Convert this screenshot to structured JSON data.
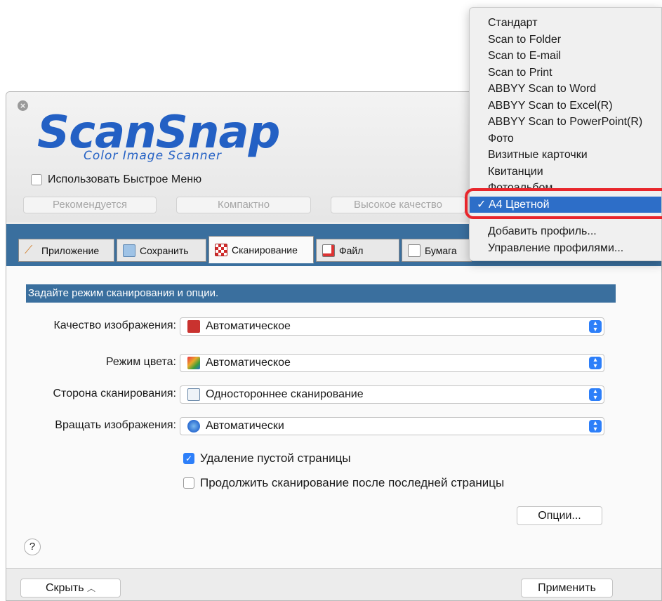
{
  "window": {
    "close_icon": "close-icon",
    "logo_title": "ScanSnap",
    "logo_subtitle": "Color Image Scanner"
  },
  "quick_menu": {
    "label": "Использовать Быстрое Меню",
    "checked": false
  },
  "presets": [
    {
      "label": "Рекомендуется"
    },
    {
      "label": "Компактно"
    },
    {
      "label": "Высокое качество"
    }
  ],
  "tabs": [
    {
      "label": "Приложение",
      "icon": "application-icon"
    },
    {
      "label": "Сохранить",
      "icon": "folder-icon"
    },
    {
      "label": "Сканирование",
      "icon": "scan-icon",
      "active": true
    },
    {
      "label": "Файл",
      "icon": "file-icon"
    },
    {
      "label": "Бумага",
      "icon": "paper-icon"
    }
  ],
  "scan_panel": {
    "header": "Задайте режим сканирования и опции.",
    "fields": [
      {
        "label": "Качество изображения:",
        "value": "Автоматическое",
        "icon": "image-quality-icon"
      },
      {
        "label": "Режим цвета:",
        "value": "Автоматическое",
        "icon": "color-mode-icon"
      },
      {
        "label": "Сторона сканирования:",
        "value": "Одностороннее сканирование",
        "icon": "scan-side-icon"
      },
      {
        "label": "Вращать изображения:",
        "value": "Автоматически",
        "icon": "rotate-icon"
      }
    ],
    "checkboxes": [
      {
        "label": "Удаление пустой страницы",
        "checked": true
      },
      {
        "label": "Продолжить сканирование после последней страницы",
        "checked": false
      }
    ],
    "options_button": "Опции...",
    "help_button": "?"
  },
  "bottom": {
    "hide_button": "Скрыть",
    "apply_button": "Применить"
  },
  "profile_menu": {
    "items": [
      "Стандарт",
      "Scan to Folder",
      "Scan to E-mail",
      "Scan to Print",
      "ABBYY Scan to Word",
      "ABBYY Scan to Excel(R)",
      "ABBYY Scan to PowerPoint(R)",
      "Фото",
      "Визитные карточки",
      "Квитанции",
      "Фотоальбом"
    ],
    "selected": "A4 Цветной",
    "check_mark": "✓",
    "actions": [
      "Добавить профиль...",
      "Управление профилями..."
    ]
  },
  "colors": {
    "accent_blue": "#3a6f9e",
    "selection_blue": "#2d6ec8",
    "logo_blue": "#2360c4",
    "highlight_red": "#e8262c"
  }
}
